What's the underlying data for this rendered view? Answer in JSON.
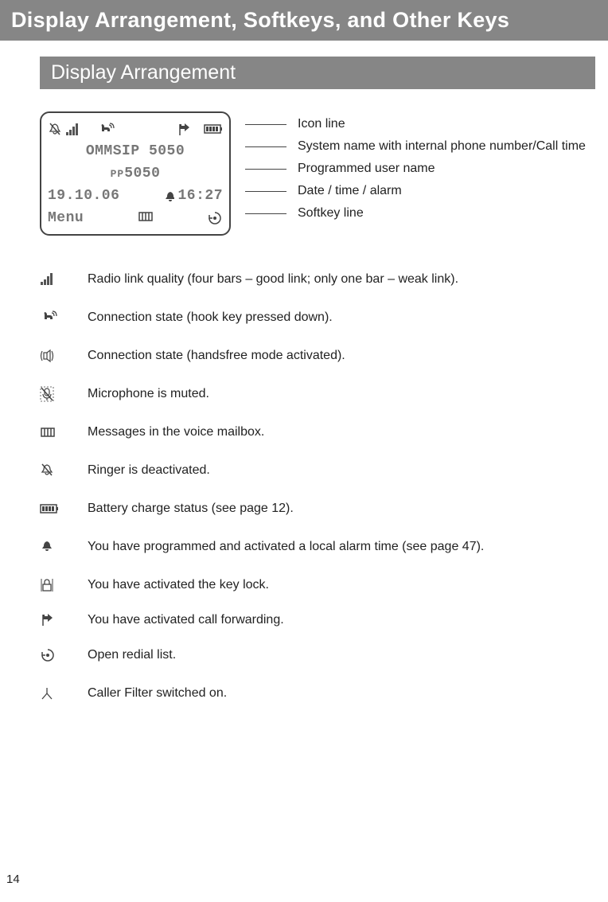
{
  "page": {
    "title": "Display Arrangement, Softkeys, and Other Keys",
    "section": "Display Arrangement",
    "number": "14"
  },
  "lcd": {
    "line2": "OMMSIP 5050",
    "line3_prefix": "PP",
    "line3_num": "5050",
    "date": "19.10.06",
    "time": "16:27",
    "menu": "Menu"
  },
  "pointers": {
    "p1": "Icon line",
    "p2": "System name with internal phone number/Call time",
    "p3": "Programmed user name",
    "p4": "Date / time / alarm",
    "p5": "Softkey line"
  },
  "legend": [
    {
      "icon": "signal-bars-icon",
      "text": "Radio link quality (four bars – good link; only one bar – weak link)."
    },
    {
      "icon": "hook-icon",
      "text": "Connection state (hook key pressed down)."
    },
    {
      "icon": "handsfree-icon",
      "text": "Connection state (handsfree mode activated)."
    },
    {
      "icon": "mic-mute-icon",
      "text": "Microphone is muted."
    },
    {
      "icon": "voicemail-icon",
      "text": "Messages in the voice mailbox."
    },
    {
      "icon": "ringer-off-icon",
      "text": "Ringer is deactivated."
    },
    {
      "icon": "battery-icon",
      "text": "Battery charge status (see page 12)."
    },
    {
      "icon": "alarm-icon",
      "text": "You have programmed and activated a local alarm time (see page 47)."
    },
    {
      "icon": "keylock-icon",
      "text": "You have activated the key lock."
    },
    {
      "icon": "call-forward-icon",
      "text": "You have activated call forwarding."
    },
    {
      "icon": "redial-icon",
      "text": "Open redial list."
    },
    {
      "icon": "caller-filter-icon",
      "text": "Caller Filter switched on."
    }
  ]
}
